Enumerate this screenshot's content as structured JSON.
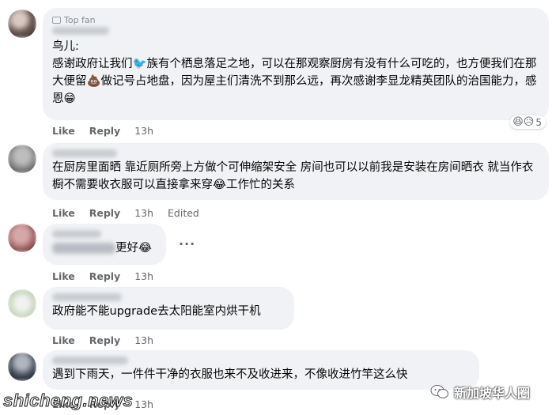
{
  "comments": [
    {
      "badge": "Top fan",
      "text": "鸟儿:\n感谢政府让我们🐦族有个栖息落足之地，可以在那观察厨房有没有什么可吃的，也方便我们在那大便留💩做记号占地盘，因为屋主们清洗不到那么远，再次感谢李显龙精英团队的治国能力，感恩😁",
      "like": "Like",
      "reply": "Reply",
      "time": "13h",
      "reaction_icons": "😆😥",
      "reaction_count": "5"
    },
    {
      "text": "在厨房里面晒 靠近厕所旁上方做个可伸缩架安全 房间也可以以前我是安装在房间晒衣 就当作衣橱不需要收衣服可以直接拿来穿😂工作忙的关系",
      "like": "Like",
      "reply": "Reply",
      "time": "13h",
      "edited": "Edited"
    },
    {
      "text_suffix": "更好😂",
      "like": "Like",
      "reply": "Reply",
      "time": "13h"
    },
    {
      "text": "政府能不能upgrade去太阳能室内烘干机",
      "like": "Like",
      "reply": "Reply",
      "time": "13h"
    },
    {
      "text": "遇到下雨天，一件件干净的衣服也来不及收进来，不像收进竹竿这么快",
      "like": "Like",
      "reply": "Reply",
      "time": "13h"
    }
  ],
  "more_options": "···",
  "watermark_left": "shicheng.news",
  "watermark_right": "新加坡华人圈",
  "colors": {
    "bubble": "#f0f2f5",
    "action_text": "#65676b",
    "text": "#050505"
  }
}
